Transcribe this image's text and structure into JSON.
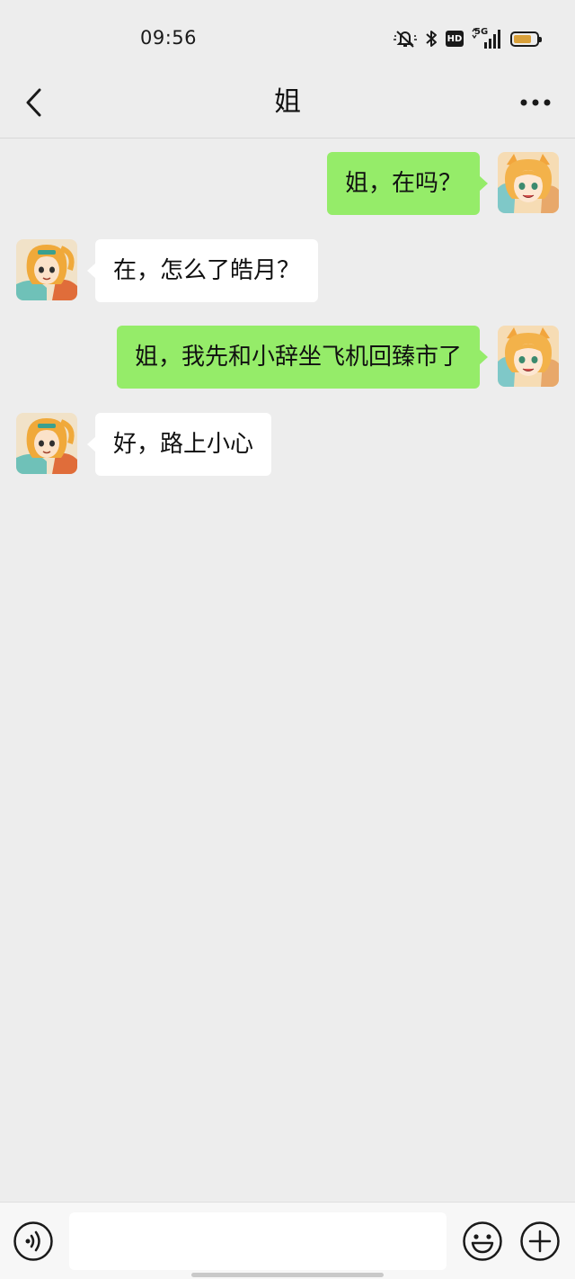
{
  "status_bar": {
    "time": "09:56",
    "hd_label": "HD",
    "network_label": "5G",
    "battery_level": 0.8,
    "battery_color": "#d9a03a"
  },
  "header": {
    "title": "姐",
    "back_icon": "chevron-left-icon",
    "more_icon": "more-dots-icon"
  },
  "messages": [
    {
      "side": "right",
      "sender": "me",
      "text": "姐，在吗？"
    },
    {
      "side": "left",
      "sender": "contact",
      "text": "在，怎么了皓月？"
    },
    {
      "side": "right",
      "sender": "me",
      "text": "姐，我先和小辞坐飞机回臻市了"
    },
    {
      "side": "left",
      "sender": "contact",
      "text": "好，路上小心"
    }
  ],
  "input_bar": {
    "value": "",
    "voice_icon": "voice-icon",
    "emoji_icon": "emoji-icon",
    "plus_icon": "plus-icon"
  },
  "colors": {
    "background": "#ededed",
    "my_bubble": "#95ec69",
    "their_bubble": "#ffffff"
  }
}
